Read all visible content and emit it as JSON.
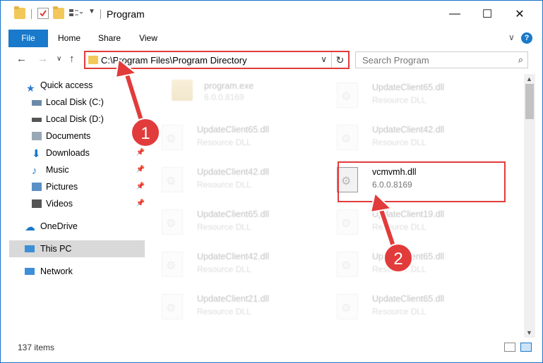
{
  "window": {
    "title": "Program",
    "minimize": "—",
    "maximize": "☐",
    "close": "✕"
  },
  "ribbon": {
    "file": "File",
    "home": "Home",
    "share": "Share",
    "view": "View",
    "collapse": "∨",
    "help": "?"
  },
  "nav": {
    "back": "←",
    "forward": "→",
    "recent": "∨",
    "up": "↑",
    "address": "C:\\Program Files\\Program Directory",
    "address_dropdown": "∨",
    "refresh": "↻",
    "search_placeholder": "Search Program",
    "search_icon": "⌕"
  },
  "sidebar": {
    "items": [
      {
        "label": "Quick access",
        "icon": "star-icon",
        "color": "#2b7bd3"
      },
      {
        "label": "Local Disk (C:)",
        "icon": "drive-icon",
        "color": "#6a8aa8"
      },
      {
        "label": "Local Disk (D:)",
        "icon": "drive-icon",
        "color": "#555555"
      },
      {
        "label": "Documents",
        "icon": "documents-icon",
        "color": "#9aa7b5"
      },
      {
        "label": "Downloads",
        "icon": "download-icon",
        "color": "#1979ca"
      },
      {
        "label": "Music",
        "icon": "music-icon",
        "color": "#1979ca"
      },
      {
        "label": "Pictures",
        "icon": "pictures-icon",
        "color": "#5b8fc6"
      },
      {
        "label": "Videos",
        "icon": "videos-icon",
        "color": "#555555"
      },
      {
        "label": "OneDrive",
        "icon": "cloud-icon",
        "color": "#1979ca"
      },
      {
        "label": "This PC",
        "icon": "computer-icon",
        "color": "#3d8fd8"
      },
      {
        "label": "Network",
        "icon": "network-icon",
        "color": "#3d8fd8"
      }
    ],
    "pin": "📌"
  },
  "files": [
    {
      "name": "program.exe",
      "sub": "6.0.0.8169"
    },
    {
      "name": "UpdateClient65.dll",
      "sub": "Resource DLL"
    },
    {
      "name": "UpdateClient65.dll",
      "sub": "Resource DLL"
    },
    {
      "name": "UpdateClient42.dll",
      "sub": "Resource DLL"
    },
    {
      "name": "UpdateClient42.dll",
      "sub": "Resource DLL"
    },
    {
      "name": "vcmvmh.dll",
      "sub": "6.0.0.8169"
    },
    {
      "name": "UpdateClient65.dll",
      "sub": "Resource DLL"
    },
    {
      "name": "UpdateClient19.dll",
      "sub": "Resource DLL"
    },
    {
      "name": "UpdateClient42.dll",
      "sub": "Resource DLL"
    },
    {
      "name": "UpdateClient65.dll",
      "sub": "Resource DLL"
    },
    {
      "name": "UpdateClient21.dll",
      "sub": "Resource DLL"
    },
    {
      "name": "UpdateClient65.dll",
      "sub": "Resource DLL"
    }
  ],
  "status": {
    "items": "137 items"
  },
  "callouts": {
    "one": "1",
    "two": "2",
    "color": "#e23b3b"
  }
}
